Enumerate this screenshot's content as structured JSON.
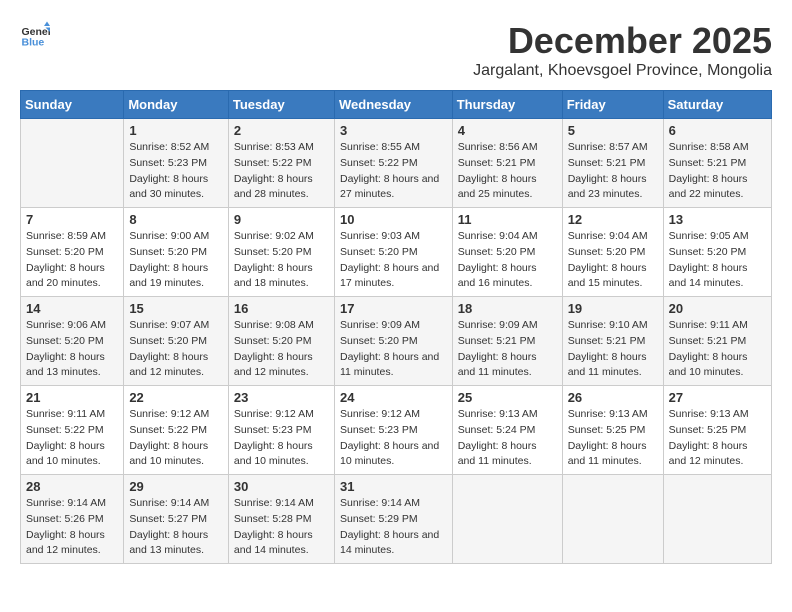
{
  "header": {
    "logo_general": "General",
    "logo_blue": "Blue",
    "title": "December 2025",
    "subtitle": "Jargalant, Khoevsgoel Province, Mongolia"
  },
  "days_of_week": [
    "Sunday",
    "Monday",
    "Tuesday",
    "Wednesday",
    "Thursday",
    "Friday",
    "Saturday"
  ],
  "weeks": [
    [
      {
        "day": "",
        "info": ""
      },
      {
        "day": "1",
        "sunrise": "Sunrise: 8:52 AM",
        "sunset": "Sunset: 5:23 PM",
        "daylight": "Daylight: 8 hours and 30 minutes."
      },
      {
        "day": "2",
        "sunrise": "Sunrise: 8:53 AM",
        "sunset": "Sunset: 5:22 PM",
        "daylight": "Daylight: 8 hours and 28 minutes."
      },
      {
        "day": "3",
        "sunrise": "Sunrise: 8:55 AM",
        "sunset": "Sunset: 5:22 PM",
        "daylight": "Daylight: 8 hours and 27 minutes."
      },
      {
        "day": "4",
        "sunrise": "Sunrise: 8:56 AM",
        "sunset": "Sunset: 5:21 PM",
        "daylight": "Daylight: 8 hours and 25 minutes."
      },
      {
        "day": "5",
        "sunrise": "Sunrise: 8:57 AM",
        "sunset": "Sunset: 5:21 PM",
        "daylight": "Daylight: 8 hours and 23 minutes."
      },
      {
        "day": "6",
        "sunrise": "Sunrise: 8:58 AM",
        "sunset": "Sunset: 5:21 PM",
        "daylight": "Daylight: 8 hours and 22 minutes."
      }
    ],
    [
      {
        "day": "7",
        "sunrise": "Sunrise: 8:59 AM",
        "sunset": "Sunset: 5:20 PM",
        "daylight": "Daylight: 8 hours and 20 minutes."
      },
      {
        "day": "8",
        "sunrise": "Sunrise: 9:00 AM",
        "sunset": "Sunset: 5:20 PM",
        "daylight": "Daylight: 8 hours and 19 minutes."
      },
      {
        "day": "9",
        "sunrise": "Sunrise: 9:02 AM",
        "sunset": "Sunset: 5:20 PM",
        "daylight": "Daylight: 8 hours and 18 minutes."
      },
      {
        "day": "10",
        "sunrise": "Sunrise: 9:03 AM",
        "sunset": "Sunset: 5:20 PM",
        "daylight": "Daylight: 8 hours and 17 minutes."
      },
      {
        "day": "11",
        "sunrise": "Sunrise: 9:04 AM",
        "sunset": "Sunset: 5:20 PM",
        "daylight": "Daylight: 8 hours and 16 minutes."
      },
      {
        "day": "12",
        "sunrise": "Sunrise: 9:04 AM",
        "sunset": "Sunset: 5:20 PM",
        "daylight": "Daylight: 8 hours and 15 minutes."
      },
      {
        "day": "13",
        "sunrise": "Sunrise: 9:05 AM",
        "sunset": "Sunset: 5:20 PM",
        "daylight": "Daylight: 8 hours and 14 minutes."
      }
    ],
    [
      {
        "day": "14",
        "sunrise": "Sunrise: 9:06 AM",
        "sunset": "Sunset: 5:20 PM",
        "daylight": "Daylight: 8 hours and 13 minutes."
      },
      {
        "day": "15",
        "sunrise": "Sunrise: 9:07 AM",
        "sunset": "Sunset: 5:20 PM",
        "daylight": "Daylight: 8 hours and 12 minutes."
      },
      {
        "day": "16",
        "sunrise": "Sunrise: 9:08 AM",
        "sunset": "Sunset: 5:20 PM",
        "daylight": "Daylight: 8 hours and 12 minutes."
      },
      {
        "day": "17",
        "sunrise": "Sunrise: 9:09 AM",
        "sunset": "Sunset: 5:20 PM",
        "daylight": "Daylight: 8 hours and 11 minutes."
      },
      {
        "day": "18",
        "sunrise": "Sunrise: 9:09 AM",
        "sunset": "Sunset: 5:21 PM",
        "daylight": "Daylight: 8 hours and 11 minutes."
      },
      {
        "day": "19",
        "sunrise": "Sunrise: 9:10 AM",
        "sunset": "Sunset: 5:21 PM",
        "daylight": "Daylight: 8 hours and 11 minutes."
      },
      {
        "day": "20",
        "sunrise": "Sunrise: 9:11 AM",
        "sunset": "Sunset: 5:21 PM",
        "daylight": "Daylight: 8 hours and 10 minutes."
      }
    ],
    [
      {
        "day": "21",
        "sunrise": "Sunrise: 9:11 AM",
        "sunset": "Sunset: 5:22 PM",
        "daylight": "Daylight: 8 hours and 10 minutes."
      },
      {
        "day": "22",
        "sunrise": "Sunrise: 9:12 AM",
        "sunset": "Sunset: 5:22 PM",
        "daylight": "Daylight: 8 hours and 10 minutes."
      },
      {
        "day": "23",
        "sunrise": "Sunrise: 9:12 AM",
        "sunset": "Sunset: 5:23 PM",
        "daylight": "Daylight: 8 hours and 10 minutes."
      },
      {
        "day": "24",
        "sunrise": "Sunrise: 9:12 AM",
        "sunset": "Sunset: 5:23 PM",
        "daylight": "Daylight: 8 hours and 10 minutes."
      },
      {
        "day": "25",
        "sunrise": "Sunrise: 9:13 AM",
        "sunset": "Sunset: 5:24 PM",
        "daylight": "Daylight: 8 hours and 11 minutes."
      },
      {
        "day": "26",
        "sunrise": "Sunrise: 9:13 AM",
        "sunset": "Sunset: 5:25 PM",
        "daylight": "Daylight: 8 hours and 11 minutes."
      },
      {
        "day": "27",
        "sunrise": "Sunrise: 9:13 AM",
        "sunset": "Sunset: 5:25 PM",
        "daylight": "Daylight: 8 hours and 12 minutes."
      }
    ],
    [
      {
        "day": "28",
        "sunrise": "Sunrise: 9:14 AM",
        "sunset": "Sunset: 5:26 PM",
        "daylight": "Daylight: 8 hours and 12 minutes."
      },
      {
        "day": "29",
        "sunrise": "Sunrise: 9:14 AM",
        "sunset": "Sunset: 5:27 PM",
        "daylight": "Daylight: 8 hours and 13 minutes."
      },
      {
        "day": "30",
        "sunrise": "Sunrise: 9:14 AM",
        "sunset": "Sunset: 5:28 PM",
        "daylight": "Daylight: 8 hours and 14 minutes."
      },
      {
        "day": "31",
        "sunrise": "Sunrise: 9:14 AM",
        "sunset": "Sunset: 5:29 PM",
        "daylight": "Daylight: 8 hours and 14 minutes."
      },
      {
        "day": "",
        "info": ""
      },
      {
        "day": "",
        "info": ""
      },
      {
        "day": "",
        "info": ""
      }
    ]
  ]
}
